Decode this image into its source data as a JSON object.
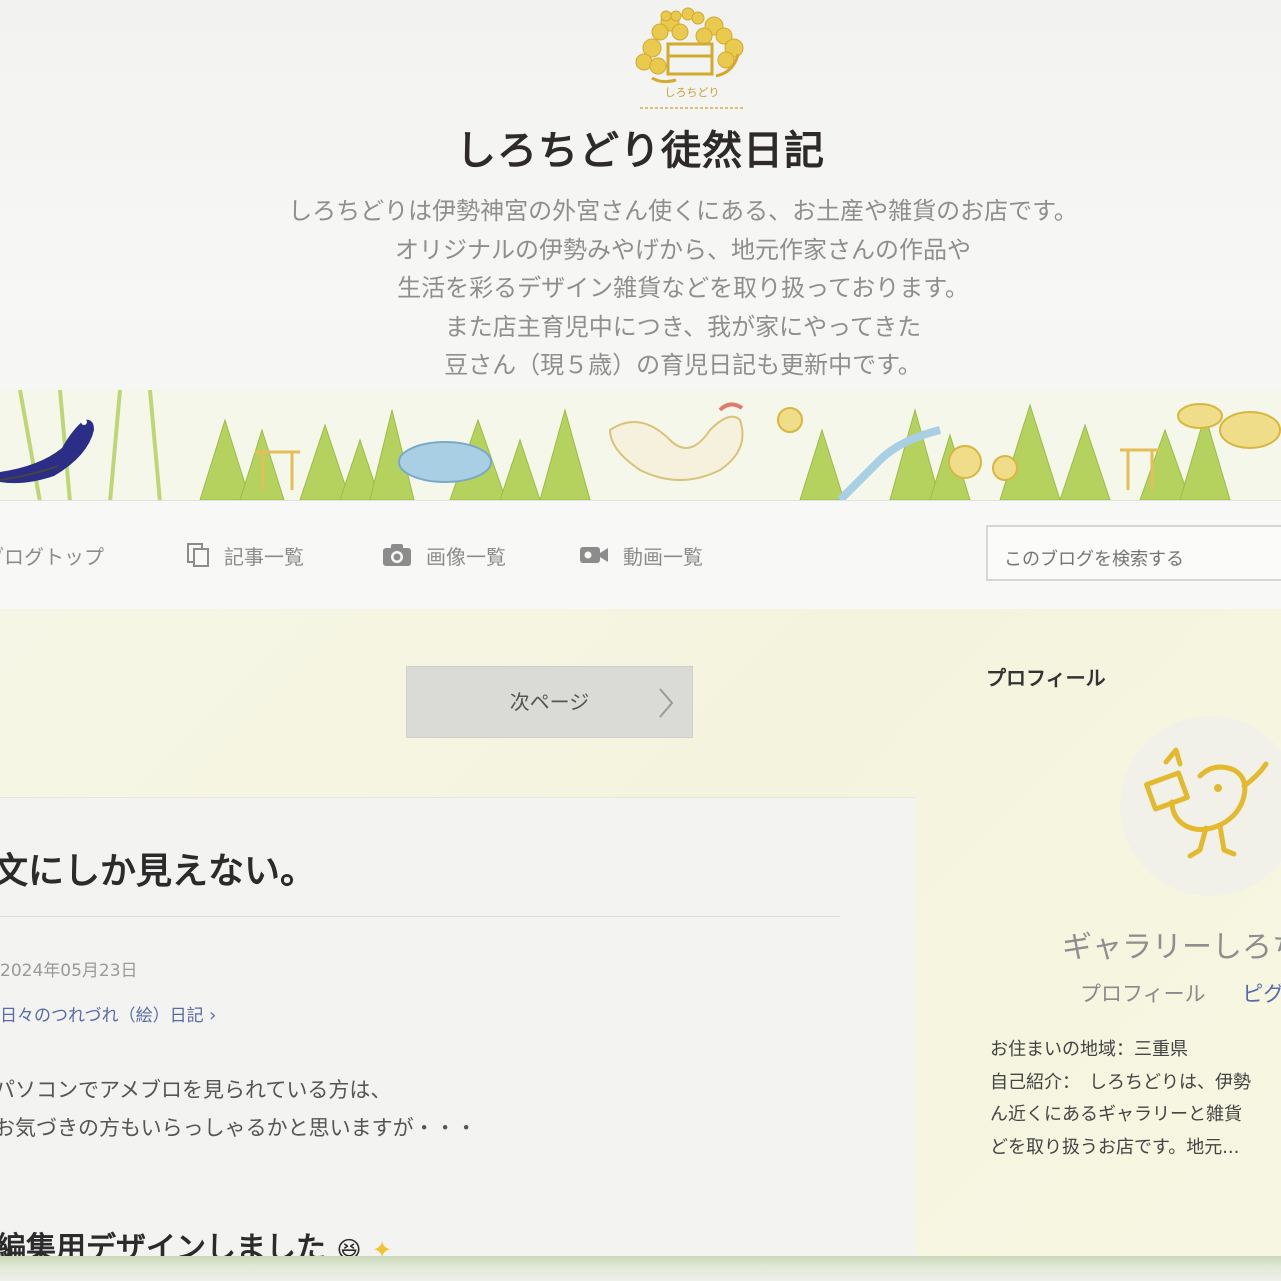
{
  "header": {
    "title": "しろちどり徒然日記",
    "description_lines": [
      "しろちどりは伊勢神宮の外宮さん使くにある、お土産や雑貨のお店です。",
      "オリジナルの伊勢みやげから、地元作家さんの作品や",
      "生活を彩るデザイン雑貨などを取り扱っております。",
      "また店主育児中につき、我が家にやってきた",
      "豆さん（現５歳）の育児日記も更新中です。"
    ],
    "logo_text": "しろちどり"
  },
  "nav": {
    "items": [
      {
        "label": "ブログトップ",
        "icon": "home-icon"
      },
      {
        "label": "記事一覧",
        "icon": "documents-icon"
      },
      {
        "label": "画像一覧",
        "icon": "camera-icon"
      },
      {
        "label": "動画一覧",
        "icon": "video-camera-icon"
      }
    ],
    "search_placeholder": "このブログを検索する"
  },
  "pager": {
    "next_label": "次ページ"
  },
  "article": {
    "title": "文にしか見えない。",
    "date": "2024年05月23日",
    "theme": "日々のつれづれ（絵）日記",
    "body_lines": [
      "パソコンでアメブロを見られている方は、",
      "お気づきの方もいらっしゃるかと思いますが・・・"
    ],
    "next_heading": "編集用デザインしました"
  },
  "sidebar": {
    "heading": "プロフィール",
    "name": "ギャラリーしろち",
    "links": [
      "プロフィール",
      "ピグの"
    ],
    "info_lines": [
      "お住まいの地域：三重県",
      "自己紹介：　しろちどりは、伊勢",
      "ん近くにあるギャラリーと雑貨",
      "どを取り扱うお店です。地元..."
    ]
  },
  "colors": {
    "accent_gold": "#e4c24a",
    "tree_green": "#b8d66a",
    "link_blue": "#5a6aa8",
    "sidebar_bg": "#f4f4de"
  }
}
